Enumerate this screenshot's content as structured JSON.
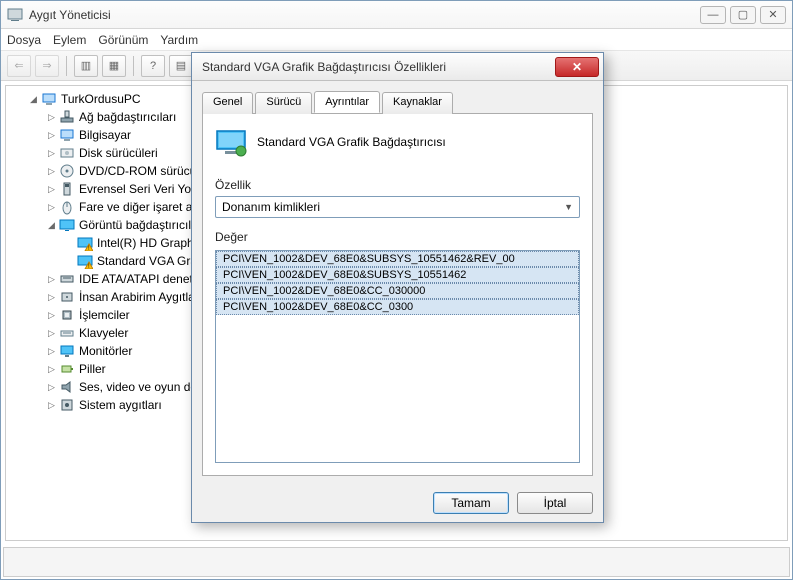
{
  "window": {
    "title": "Aygıt Yöneticisi",
    "buttons": {
      "min": "—",
      "max": "▢",
      "close": "✕"
    }
  },
  "menu": {
    "file": "Dosya",
    "action": "Eylem",
    "view": "Görünüm",
    "help": "Yardım"
  },
  "tree": {
    "root": "TurkOrdusuPC",
    "items": [
      {
        "label": "Ağ bağdaştırıcıları",
        "icon": "network"
      },
      {
        "label": "Bilgisayar",
        "icon": "computer"
      },
      {
        "label": "Disk sürücüleri",
        "icon": "disk"
      },
      {
        "label": "DVD/CD-ROM sürücüleri",
        "icon": "dvd"
      },
      {
        "label": "Evrensel Seri Veri Yolu denetleyicileri",
        "icon": "usb"
      },
      {
        "label": "Fare ve diğer işaret aygıtları",
        "icon": "mouse"
      }
    ],
    "display_adapters": {
      "label": "Görüntü bağdaştırıcıları",
      "items": [
        "Intel(R) HD Graphics",
        "Standard VGA Grafik Bağdaştırıcısı"
      ]
    },
    "rest": [
      {
        "label": "IDE ATA/ATAPI denetleyicileri",
        "icon": "ide"
      },
      {
        "label": "İnsan Arabirim Aygıtları",
        "icon": "hid"
      },
      {
        "label": "İşlemciler",
        "icon": "cpu"
      },
      {
        "label": "Klavyeler",
        "icon": "keyboard"
      },
      {
        "label": "Monitörler",
        "icon": "monitor"
      },
      {
        "label": "Piller",
        "icon": "battery"
      },
      {
        "label": "Ses, video ve oyun denetleyicileri",
        "icon": "sound"
      },
      {
        "label": "Sistem aygıtları",
        "icon": "system"
      }
    ]
  },
  "dialog": {
    "title": "Standard VGA Grafik Bağdaştırıcısı Özellikleri",
    "tabs": {
      "general": "Genel",
      "driver": "Sürücü",
      "details": "Ayrıntılar",
      "resources": "Kaynaklar"
    },
    "device_name": "Standard VGA Grafik Bağdaştırıcısı",
    "property_label": "Özellik",
    "property_selected": "Donanım kimlikleri",
    "value_label": "Değer",
    "values": [
      "PCI\\VEN_1002&DEV_68E0&SUBSYS_10551462&REV_00",
      "PCI\\VEN_1002&DEV_68E0&SUBSYS_10551462",
      "PCI\\VEN_1002&DEV_68E0&CC_030000",
      "PCI\\VEN_1002&DEV_68E0&CC_0300"
    ],
    "buttons": {
      "ok": "Tamam",
      "cancel": "İptal"
    },
    "close": "✕"
  }
}
